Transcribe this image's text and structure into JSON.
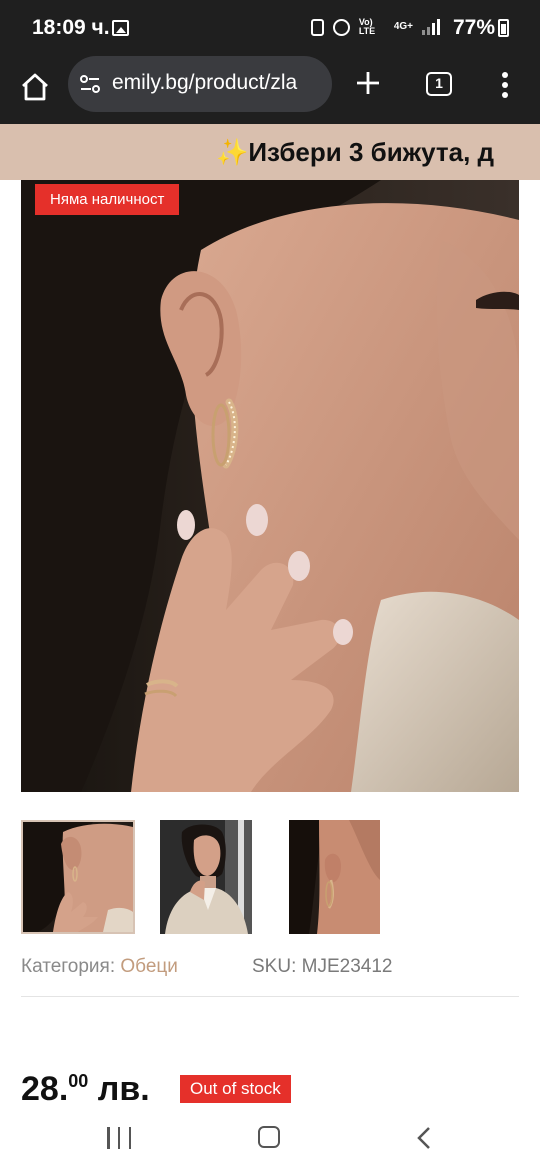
{
  "status_bar": {
    "time": "18:09 ч.",
    "network_lte": "Vo) LTE",
    "network_4g": "4G+",
    "battery": "77%",
    "icons": [
      "gallery-icon",
      "battery-saver-icon",
      "alarm-icon",
      "volte-icon",
      "4g-icon",
      "signal-icon",
      "battery-icon"
    ]
  },
  "browser": {
    "url": "emily.bg/product/zla",
    "tab_count": "1",
    "icons": [
      "home-icon",
      "site-settings-icon",
      "new-tab-icon",
      "tab-switcher-icon",
      "more-menu-icon"
    ]
  },
  "banner": {
    "text": "✨Избери 3 бижута, д"
  },
  "product": {
    "badge_sold_out": "Няма наличност",
    "category_label": "Категория:",
    "category_value": "Обеци",
    "sku_label": "SKU:",
    "sku_value": "MJE23412",
    "price_main": "28.",
    "price_cents": "00",
    "price_currency": "лв.",
    "stock_status": "Out of stock",
    "thumbnails_count": 3,
    "selected_thumbnail": 1
  },
  "colors": {
    "banner_bg": "#d9bfae",
    "badge_red": "#e5302a",
    "accent_link": "#c29c7e",
    "toolbar_bg": "#1f1f1f",
    "url_bar_bg": "#3a3b3f"
  },
  "nav_bar": {
    "icons": [
      "recents-icon",
      "home-button-icon",
      "back-icon"
    ]
  }
}
